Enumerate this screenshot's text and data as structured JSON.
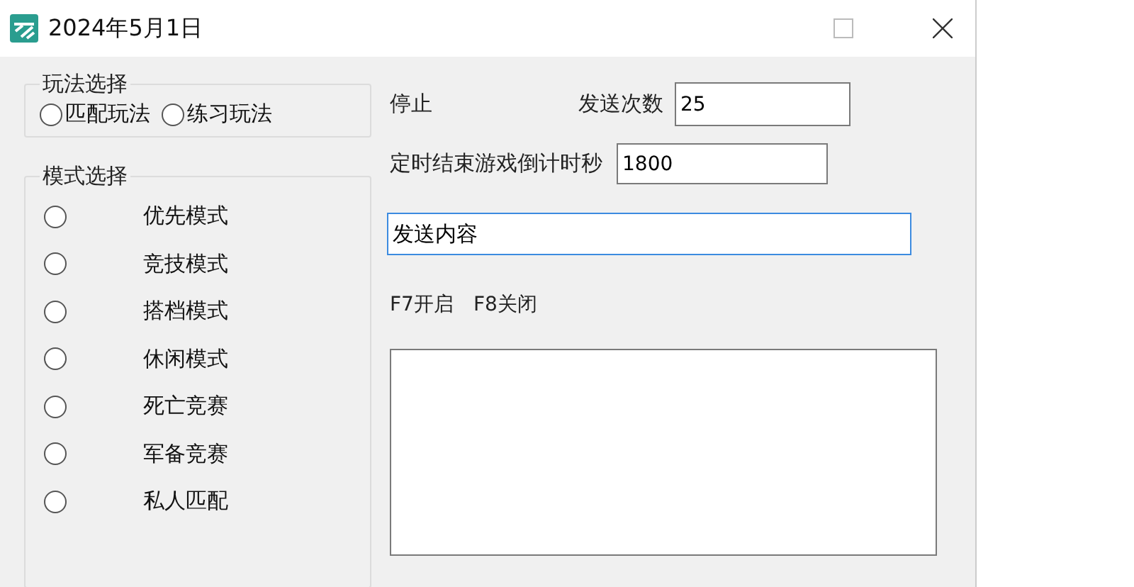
{
  "window": {
    "title": "2024年5月1日"
  },
  "play_group": {
    "title": "玩法选择",
    "options": [
      {
        "label": "匹配玩法",
        "selected": false
      },
      {
        "label": "练习玩法",
        "selected": false
      }
    ]
  },
  "mode_group": {
    "title": "模式选择",
    "options": [
      {
        "label": "优先模式",
        "selected": false
      },
      {
        "label": "竞技模式",
        "selected": false
      },
      {
        "label": "搭档模式",
        "selected": false
      },
      {
        "label": "休闲模式",
        "selected": false
      },
      {
        "label": "死亡竞赛",
        "selected": false
      },
      {
        "label": "军备竞赛",
        "selected": false
      },
      {
        "label": "私人匹配",
        "selected": false
      }
    ]
  },
  "status": "停止",
  "send_count": {
    "label": "发送次数",
    "value": "25"
  },
  "timer": {
    "label": "定时结束游戏倒计时秒",
    "value": "1800"
  },
  "send_content": {
    "value": "发送内容",
    "focused": true
  },
  "hotkeys": "F7开启　F8关闭"
}
